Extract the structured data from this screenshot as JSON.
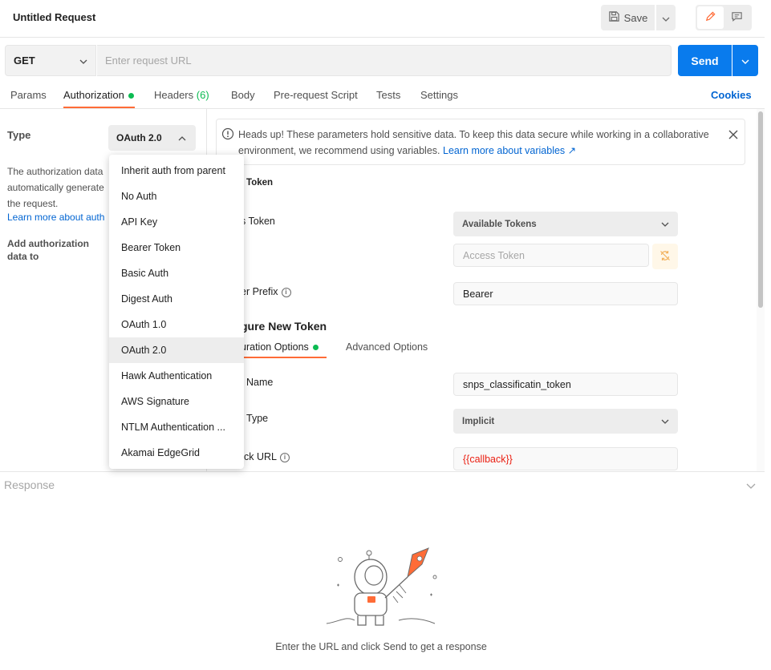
{
  "header": {
    "title": "Untitled Request",
    "save_label": "Save",
    "save_icon": "floppy-disk-icon",
    "edit_icon": "pencil-icon",
    "comment_icon": "comment-icon"
  },
  "request": {
    "method": "GET",
    "url_placeholder": "Enter request URL",
    "send_label": "Send"
  },
  "tabs": {
    "items": [
      {
        "label": "Params"
      },
      {
        "label": "Authorization"
      },
      {
        "label": "Headers",
        "count": "(6)"
      },
      {
        "label": "Body"
      },
      {
        "label": "Pre-request Script"
      },
      {
        "label": "Tests"
      },
      {
        "label": "Settings"
      }
    ],
    "active": "Authorization",
    "cookies_label": "Cookies"
  },
  "auth_panel": {
    "type_label": "Type",
    "type_value": "OAuth 2.0",
    "desc_line1": "The authorization data",
    "desc_line2": "automatically generate",
    "desc_line3": "the request.",
    "learn_more": "Learn more about auth",
    "add_auth_label": "Add authorization data to"
  },
  "auth_dropdown": {
    "items": [
      "Inherit auth from parent",
      "No Auth",
      "API Key",
      "Bearer Token",
      "Basic Auth",
      "Digest Auth",
      "OAuth 1.0",
      "OAuth 2.0",
      "Hawk Authentication",
      "AWS Signature",
      "NTLM Authentication ...",
      "Akamai EdgeGrid"
    ],
    "selected": "OAuth 2.0"
  },
  "alert": {
    "text": "Heads up! These parameters hold sensitive data. To keep this data secure while working in a collaborative environment, we recommend using variables.",
    "link": "Learn more about variables ↗"
  },
  "form": {
    "current_token_heading": "t Token",
    "access_token_label": "s Token",
    "available_tokens": "Available Tokens",
    "access_token_placeholder": "Access Token",
    "header_prefix_label": "er Prefix",
    "header_prefix_value": "Bearer",
    "configure_heading": "gure New Token",
    "config_tab": "uration Options",
    "advanced_tab": "Advanced Options",
    "token_name_label": "Name",
    "token_name_value": "snps_classificatin_token",
    "grant_type_label": "Type",
    "grant_type_value": "Implicit",
    "callback_label": "ck URL",
    "callback_value": "{{callback}}"
  },
  "response": {
    "label": "Response",
    "hint": "Enter the URL and click Send to get a response"
  },
  "colors": {
    "accent": "#ff6c37",
    "primary": "#097bed",
    "success": "#0cbb52",
    "link": "#0265d2",
    "variable": "#eb2013"
  }
}
